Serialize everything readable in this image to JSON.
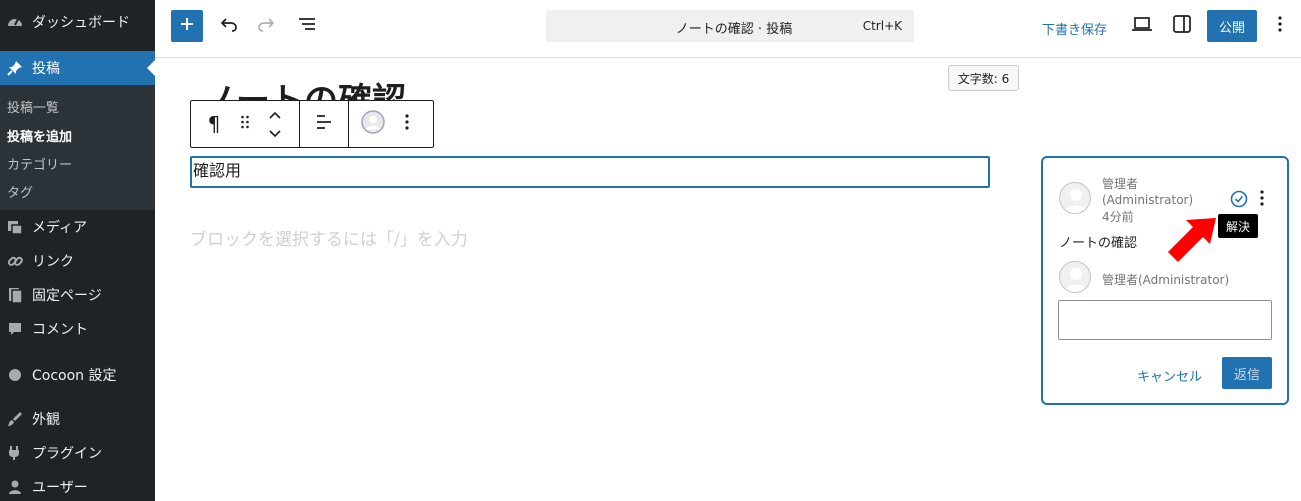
{
  "sidebar": {
    "items": [
      {
        "label": "ダッシュボード",
        "icon": "dashboard-icon"
      },
      {
        "label": "投稿",
        "icon": "pin-icon",
        "active": true
      },
      {
        "label": "メディア",
        "icon": "media-icon"
      },
      {
        "label": "リンク",
        "icon": "link-icon"
      },
      {
        "label": "固定ページ",
        "icon": "page-icon"
      },
      {
        "label": "コメント",
        "icon": "comment-icon"
      },
      {
        "label": "Cocoon 設定",
        "icon": "circle-icon"
      },
      {
        "label": "外観",
        "icon": "brush-icon"
      },
      {
        "label": "プラグイン",
        "icon": "plugin-icon"
      },
      {
        "label": "ユーザー",
        "icon": "user-icon"
      }
    ],
    "submenu": [
      {
        "label": "投稿一覧"
      },
      {
        "label": "投稿を追加",
        "current": true
      },
      {
        "label": "カテゴリー"
      },
      {
        "label": "タグ"
      }
    ]
  },
  "header": {
    "command_title": "ノートの確認 · 投稿",
    "shortcut": "Ctrl+K",
    "save_draft": "下書き保存",
    "publish": "公開"
  },
  "editor": {
    "word_count": "文字数: 6",
    "post_title": "ノートの確認",
    "paragraph": "確認用",
    "placeholder": "ブロックを選択するには「/」を入力"
  },
  "note": {
    "author": "管理者",
    "author_role": "(Administrator)",
    "time": "4分前",
    "text": "ノートの確認",
    "reply_author": "管理者(Administrator)",
    "resolve_tooltip": "解決",
    "cancel": "キャンセル",
    "reply": "返信"
  },
  "colors": {
    "sidebar_bg": "#1d2327",
    "accent": "#2271b1",
    "arrow": "#ff0000"
  }
}
